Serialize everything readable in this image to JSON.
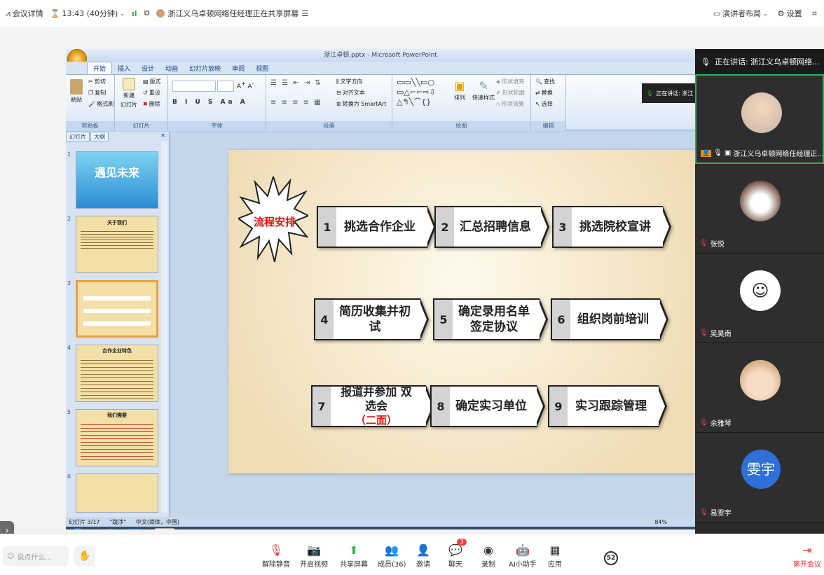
{
  "topbar": {
    "meeting_info": "会议详情",
    "timer": "13:43 (40分钟)",
    "sharing_status": "浙江义乌卓顿网络任经理正在共享屏幕",
    "layout": "演讲者布局",
    "settings": "设置"
  },
  "ppt": {
    "window_title": "浙江卓顿.pptx - Microsoft PowerPoint",
    "tabs": [
      "开始",
      "插入",
      "设计",
      "动画",
      "幻灯片放映",
      "审阅",
      "视图"
    ],
    "groups": [
      "剪贴板",
      "幻灯片",
      "字体",
      "段落",
      "绘图",
      "编辑"
    ],
    "clipboard": {
      "paste": "粘贴",
      "cut": "剪切",
      "copy": "复制",
      "format": "格式刷"
    },
    "slides_group": {
      "new": "新建",
      "new2": "幻灯片",
      "layout": "版式",
      "reset": "重设",
      "delete": "删除"
    },
    "paragraph": {
      "dir": "文字方向",
      "align": "对齐文本",
      "smart": "转换为 SmartArt"
    },
    "drawing": {
      "arrange": "排列",
      "quick": "快速样式",
      "fill": "形状填充",
      "outline": "形状轮廓",
      "effect": "形状效果"
    },
    "editing": {
      "find": "查找",
      "replace": "替换",
      "select": "选择"
    },
    "speaking_mini": "正在讲话: 浙江",
    "pane_tabs": [
      "幻灯片",
      "大纲"
    ],
    "thumb_titles": [
      "遇见未来",
      "关于我们",
      "",
      "合作企业特色",
      "我们需要",
      ""
    ],
    "status": {
      "slide": "幻灯片 3/17",
      "theme": "\"跋涉\"",
      "lang": "中文(简体，中国)",
      "zoom": "84%"
    }
  },
  "slide": {
    "badge": "流程安排",
    "steps": [
      {
        "n": "1",
        "text": "挑选合作企业"
      },
      {
        "n": "2",
        "text": "汇总招聘信息"
      },
      {
        "n": "3",
        "text": "挑选院校宣讲"
      },
      {
        "n": "4",
        "text": "简历收集并初试"
      },
      {
        "n": "5",
        "text": "确定录用名单 签定协议"
      },
      {
        "n": "6",
        "text": "组织岗前培训"
      },
      {
        "n": "7",
        "text": "报道并参加 双选会",
        "extra": "（二面）"
      },
      {
        "n": "8",
        "text": "确定实习单位"
      },
      {
        "n": "9",
        "text": "实习跟踪管理"
      }
    ]
  },
  "panel": {
    "speaking": "正在讲话: 浙江义乌卓顿网络...",
    "participants": [
      {
        "name": "浙江义乌卓顿网络任经理正...",
        "active": true
      },
      {
        "name": "张悦"
      },
      {
        "name": "吴昊南"
      },
      {
        "name": "余雅琴"
      },
      {
        "name": "易雯宇",
        "initials": "雯宇"
      }
    ]
  },
  "bottombar": {
    "say": "说点什么...",
    "buttons": [
      {
        "label": "解除静音"
      },
      {
        "label": "开启视频"
      },
      {
        "label": "共享屏幕"
      },
      {
        "label": "成员(36)"
      },
      {
        "label": "邀请"
      },
      {
        "label": "聊天",
        "badge": "3"
      },
      {
        "label": "录制"
      },
      {
        "label": "AI小助手"
      },
      {
        "label": "应用"
      }
    ],
    "count_badge": "52",
    "leave": "离开会议"
  }
}
